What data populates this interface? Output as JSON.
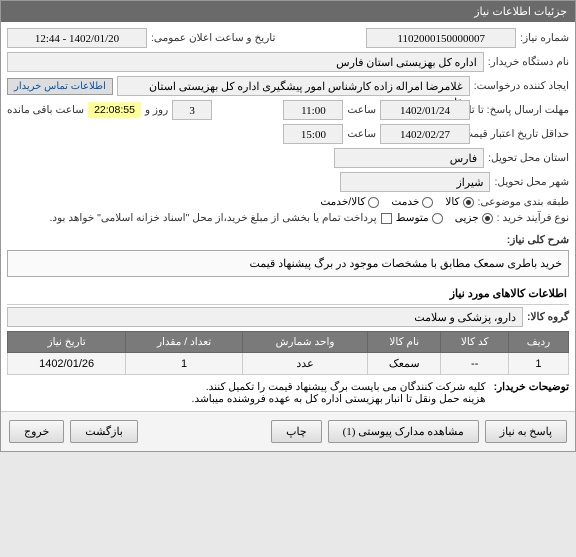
{
  "header": {
    "title": "جزئیات اطلاعات نیاز"
  },
  "form": {
    "need_no_label": "شماره نیاز:",
    "need_no": "1102000150000007",
    "announce_dt_label": "تاریخ و ساعت اعلان عمومی:",
    "announce_dt": "1402/01/20 - 12:44",
    "buyer_label": "نام دستگاه خریدار:",
    "buyer": "اداره کل بهزیستی استان فارس",
    "requester_label": "ایجاد کننده درخواست:",
    "requester": "غلامرضا امراله زاده کارشناس امور پیشگیری اداره کل بهزیستی استان فارس",
    "contact_link": "اطلاعات تماس خریدار",
    "deadline_label": "مهلت ارسال پاسخ: تا تاریخ:",
    "deadline_date": "1402/01/24",
    "time_label": "ساعت",
    "deadline_time": "11:00",
    "day_and_label": "روز و",
    "remaining_days": "3",
    "remaining_time": "22:08:55",
    "remaining_caption": "ساعت باقی مانده",
    "price_valid_label": "حداقل تاریخ اعتبار قیمت: تا تاریخ:",
    "price_valid_date": "1402/02/27",
    "price_valid_time": "15:00",
    "province_label": "استان محل تحویل:",
    "province": "فارس",
    "city_label": "شهر محل تحویل:",
    "city": "شیراز",
    "subject_cat_label": "طبقه بندی موضوعی:",
    "cat_goods": "کالا",
    "cat_service": "خدمت",
    "cat_both": "کالا/خدمت",
    "purchase_type_label": "نوع فرآیند خرید :",
    "pt_partial": "جزیی",
    "pt_medium": "متوسط",
    "payment_note": "پرداخت تمام یا بخشی از مبلغ خرید،از محل \"اسناد خزانه اسلامی\" خواهد بود."
  },
  "desc": {
    "label": "شرح کلی نیاز:",
    "text": "خرید باطری سمعک مطابق با مشخصات موجود در برگ پیشنهاد قیمت"
  },
  "items": {
    "title": "اطلاعات کالاهای مورد نیاز",
    "group_label": "گروه کالا:",
    "group": "دارو، پزشکی و سلامت",
    "headers": {
      "row": "ردیف",
      "code": "کد کالا",
      "name": "نام کالا",
      "unit": "واحد شمارش",
      "qty": "تعداد / مقدار",
      "date": "تاریخ نیاز"
    },
    "rows": [
      {
        "row": "1",
        "code": "--",
        "name": "سمعک",
        "unit": "عدد",
        "qty": "1",
        "date": "1402/01/26"
      }
    ]
  },
  "buyer_notes": {
    "label": "توضیحات خریدار:",
    "line1": "کلیه شرکت کنندگان می بایست برگ پیشنهاد قیمت را تکمیل کنند.",
    "line2": "هزینه حمل ونقل تا انبار بهزیستی اداره کل به عهده فروشنده میباشد."
  },
  "buttons": {
    "reply": "پاسخ به نیاز",
    "attachments": "مشاهده مدارک پیوستی (1)",
    "print": "چاپ",
    "back": "بازگشت",
    "exit": "خروج"
  }
}
